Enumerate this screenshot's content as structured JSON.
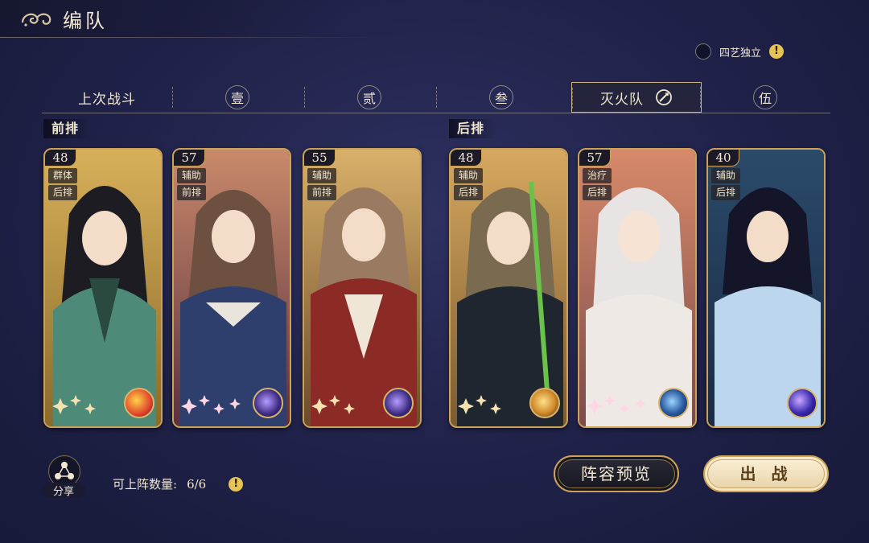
{
  "header": {
    "title": "编队"
  },
  "toggle": {
    "label": "四艺独立",
    "hint": "!"
  },
  "tabs": [
    {
      "label": "上次战斗",
      "type": "text"
    },
    {
      "label": "壹",
      "type": "badge"
    },
    {
      "label": "贰",
      "type": "badge"
    },
    {
      "label": "叁",
      "type": "badge"
    },
    {
      "label": "灭火队",
      "type": "active"
    },
    {
      "label": "伍",
      "type": "badge"
    }
  ],
  "rows": {
    "front": "前排",
    "back": "后排"
  },
  "cards": [
    {
      "level": "48",
      "role": "群体",
      "position": "后排",
      "stars": 3,
      "element": "red-orange-orb"
    },
    {
      "level": "57",
      "role": "辅助",
      "position": "前排",
      "stars": 4,
      "element": "purple-planet-orb"
    },
    {
      "level": "55",
      "role": "辅助",
      "position": "前排",
      "stars": 3,
      "element": "purple-planet-orb"
    },
    {
      "level": "48",
      "role": "辅助",
      "position": "后排",
      "stars": 3,
      "element": "gold-dotted-orb"
    },
    {
      "level": "57",
      "role": "治疗",
      "position": "后排",
      "stars": 4,
      "element": "blue-star-orb"
    },
    {
      "level": "40",
      "role": "辅助",
      "position": "后排",
      "stars": 0,
      "element": "dark-blue-orb"
    }
  ],
  "bottom": {
    "share_label": "分享",
    "capacity_label": "可上阵数量:",
    "capacity_value": "6/6",
    "hint": "!",
    "preview_label": "阵容预览",
    "deploy_label": "出 战"
  },
  "colors": {
    "gold": "#caa25a",
    "background": "#1f2148",
    "text": "#f1e6cf",
    "hint": "#e7c254"
  }
}
